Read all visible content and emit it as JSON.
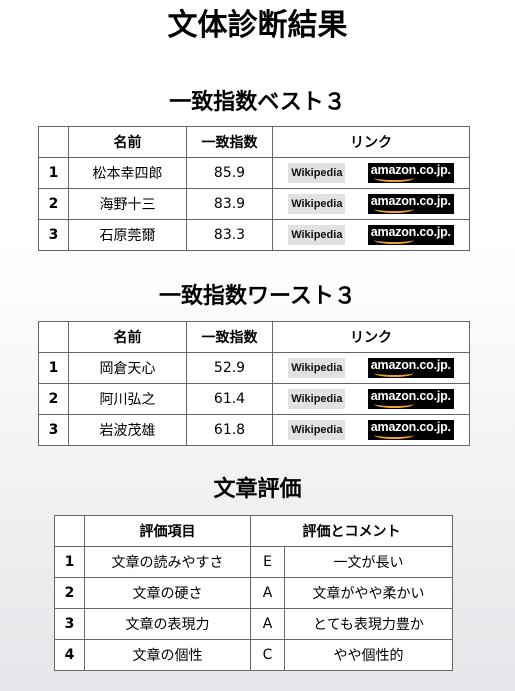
{
  "page_title": "文体診断結果",
  "best": {
    "title": "一致指数ベスト３",
    "headers": {
      "rank": "",
      "name": "名前",
      "index": "一致指数",
      "links": "リンク"
    },
    "rows": [
      {
        "rank": "1",
        "name": "松本幸四郎",
        "index": "85.9"
      },
      {
        "rank": "2",
        "name": "海野十三",
        "index": "83.9"
      },
      {
        "rank": "3",
        "name": "石原莞爾",
        "index": "83.3"
      }
    ]
  },
  "worst": {
    "title": "一致指数ワースト３",
    "headers": {
      "rank": "",
      "name": "名前",
      "index": "一致指数",
      "links": "リンク"
    },
    "rows": [
      {
        "rank": "1",
        "name": "岡倉天心",
        "index": "52.9"
      },
      {
        "rank": "2",
        "name": "阿川弘之",
        "index": "61.4"
      },
      {
        "rank": "3",
        "name": "岩波茂雄",
        "index": "61.8"
      }
    ]
  },
  "link_labels": {
    "wikipedia": "Wikipedia",
    "amazon": "amazon.co.jp."
  },
  "evaluation": {
    "title": "文章評価",
    "headers": {
      "rank": "",
      "item": "評価項目",
      "result": "評価とコメント"
    },
    "rows": [
      {
        "rank": "1",
        "item": "文章の読みやすさ",
        "grade": "E",
        "comment": "一文が長い"
      },
      {
        "rank": "2",
        "item": "文章の硬さ",
        "grade": "A",
        "comment": "文章がやや柔かい"
      },
      {
        "rank": "3",
        "item": "文章の表現力",
        "grade": "A",
        "comment": "とても表現力豊か"
      },
      {
        "rank": "4",
        "item": "文章の個性",
        "grade": "C",
        "comment": "やや個性的"
      }
    ]
  }
}
